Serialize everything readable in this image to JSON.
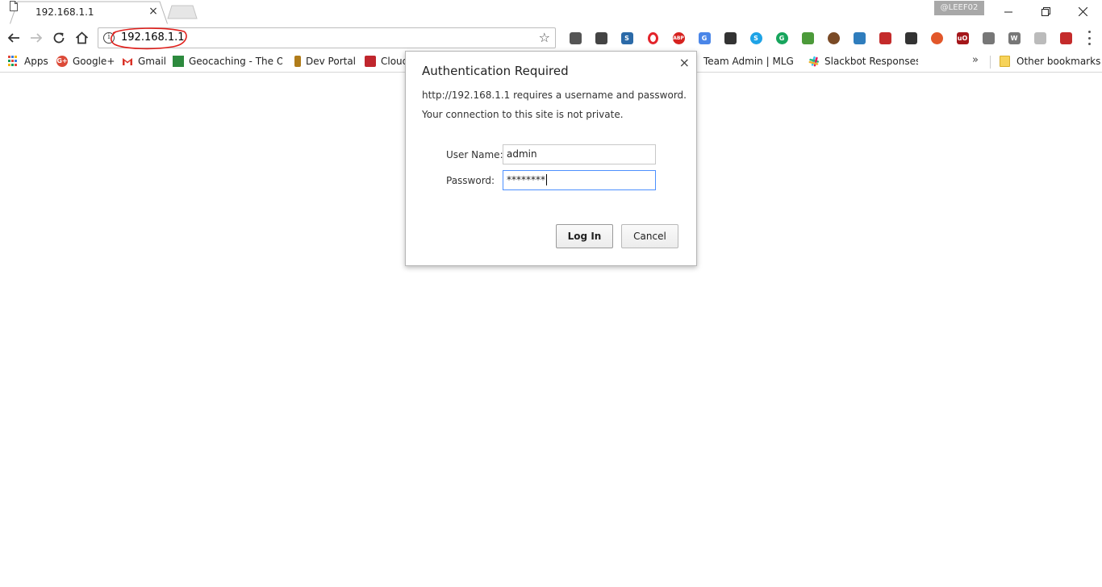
{
  "tab": {
    "title": "192.168.1.1",
    "close_glyph": "×"
  },
  "window": {
    "profile_name": "@LEEF02"
  },
  "address_bar": {
    "url": "192.168.1.1",
    "annotation_color": "#e0201c"
  },
  "extensions": [
    {
      "name": "cast-icon",
      "color": "#555555",
      "glyph": ""
    },
    {
      "name": "film-icon",
      "color": "#444444",
      "glyph": ""
    },
    {
      "name": "s-extension-icon",
      "color": "#2b6aa8",
      "glyph": "S"
    },
    {
      "name": "opera-icon",
      "color": "#e3242b",
      "glyph": "O"
    },
    {
      "name": "adblock-plus-icon",
      "color": "#d6221f",
      "glyph": "ABP"
    },
    {
      "name": "google-translate-icon",
      "color": "#4a86e8",
      "glyph": "G"
    },
    {
      "name": "incognito-icon",
      "color": "#333333",
      "glyph": ""
    },
    {
      "name": "skype-icon",
      "color": "#1ea3e6",
      "glyph": "S"
    },
    {
      "name": "grammarly-icon",
      "color": "#18a55d",
      "glyph": "G"
    },
    {
      "name": "green-extension-icon",
      "color": "#4c9a3a",
      "glyph": ""
    },
    {
      "name": "avatar-extension-icon",
      "color": "#7a4a26",
      "glyph": ""
    },
    {
      "name": "person-extension-icon",
      "color": "#2f7dbd",
      "glyph": ""
    },
    {
      "name": "flag-icon",
      "color": "#c42b2b",
      "glyph": ""
    },
    {
      "name": "hat-icon",
      "color": "#333333",
      "glyph": ""
    },
    {
      "name": "orange-extension-icon",
      "color": "#e2572a",
      "glyph": ""
    },
    {
      "name": "ublock-icon",
      "color": "#a4161a",
      "glyph": "uO"
    },
    {
      "name": "camera-icon",
      "color": "#777777",
      "glyph": ""
    },
    {
      "name": "wordpress-icon",
      "color": "#777777",
      "glyph": "W"
    },
    {
      "name": "dots-extension-icon",
      "color": "#bbbbbb",
      "glyph": ""
    },
    {
      "name": "red-chart-extension-icon",
      "color": "#c42b2b",
      "glyph": ""
    }
  ],
  "bookmarks": {
    "apps": "Apps",
    "google_plus": "Google+",
    "gmail": "Gmail",
    "geocaching": "Geocaching - The Offi",
    "dev_portal": "Dev Portal",
    "cloud": "Cloud",
    "team_admin": "Team Admin | MLG Da",
    "slackbot": "Slackbot Responses | !",
    "overflow": "»",
    "other": "Other bookmarks"
  },
  "dialog": {
    "title": "Authentication Required",
    "line1": "http://192.168.1.1 requires a username and password.",
    "line2": "Your connection to this site is not private.",
    "username_label": "User Name:",
    "username_value": "admin",
    "password_label": "Password:",
    "password_value": "********",
    "login_label": "Log In",
    "cancel_label": "Cancel",
    "close_glyph": "×"
  }
}
